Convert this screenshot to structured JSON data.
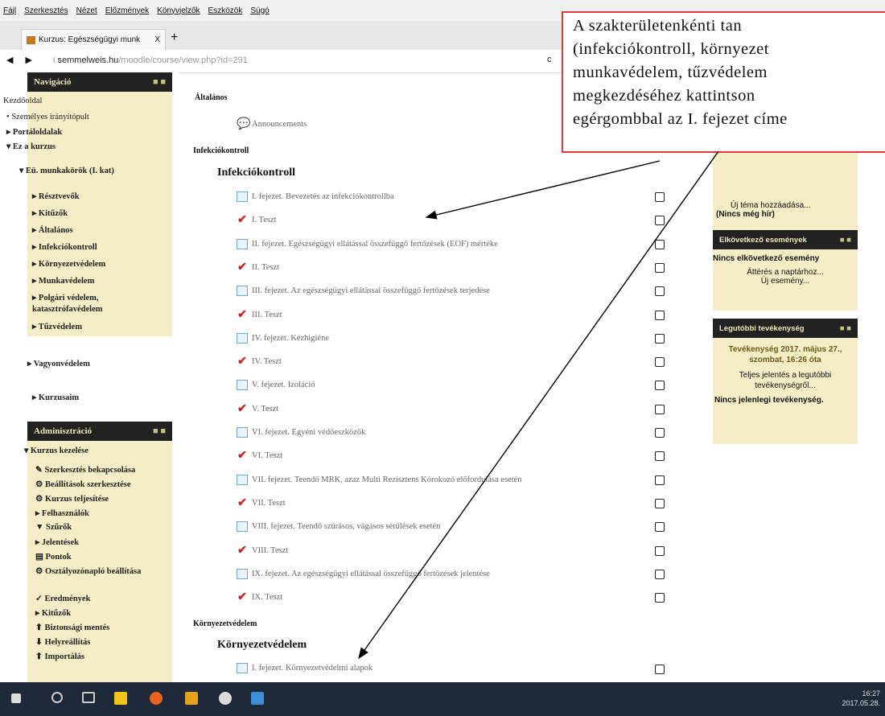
{
  "menu": [
    "Fájl",
    "Szerkesztés",
    "Nézet",
    "Előzmények",
    "Könyvjelzők",
    "Eszközök",
    "Súgó"
  ],
  "tab": {
    "title": "Kurzus: Egészségügyi munk",
    "close": "X",
    "new": "+"
  },
  "url": {
    "prefix": "i.",
    "host": "semmelweis.hu",
    "rest": "/moodle/course/view.php?id=291"
  },
  "navigation": {
    "title": "Navigáció",
    "home": "Kezdőoldal",
    "items": [
      "Személyes irányítópult",
      "Portáloldalak",
      "Ez a kurzus"
    ],
    "course": "Eü. munkakörök (I. kat)",
    "course_items": [
      "Résztvevők",
      "Kitűzők",
      "Általános",
      "Infekciókontroll",
      "Környezetvédelem",
      "Munkavédelem",
      "Polgári védelem, katasztrófavédelem",
      "Tűzvédelem",
      "Vagyonvédelem"
    ],
    "courses": "Kurzusaim"
  },
  "admin": {
    "title": "Adminisztráció",
    "section": "Kurzus kezelése",
    "items": [
      "Szerkesztés bekapcsolása",
      "Beállítások szerkesztése",
      "Kurzus teljesítése",
      "Felhasználók",
      "Szűrők",
      "Jelentések",
      "Pontok",
      "Osztályozónapló beállítása",
      "Eredmények",
      "Kitűzők",
      "Biztonsági mentés",
      "Helyreállítás",
      "Importálás"
    ]
  },
  "main": {
    "general_label": "Általános",
    "announcements": "Announcements",
    "infek_label": "Infekciókontroll",
    "infek_title": "Infekciókontroll",
    "rows": [
      "I. fejezet. Bevezetés az infekciókontrollba",
      "I. Teszt",
      "II. fejezet. Egészségügyi ellátással összefüggő fertőzések (EOF) mértéke",
      "II. Teszt",
      "III. fejezet. Az egészségügyi ellátással összefüggő fertőzések terjedése",
      "III. Teszt",
      "IV. fejezet. Kézhigiéne",
      "IV. Teszt",
      "V. fejezet. Izoláció",
      "V. Teszt",
      "VI. fejezet. Egyéni védőeszközök",
      "VI. Teszt",
      "VII. fejezet. Teendő MRK, azaz Multi Rezisztens Kórokozó előfordulása esetén",
      "VII. Teszt",
      "VIII. fejezet. Teendő szúrásos, vágásos sérülések esetén",
      "VIII. Teszt",
      "IX. fejezet. Az egészségügyi ellátással összefüggő fertőzések jelentése",
      "IX. Teszt"
    ],
    "env_label": "Környezetvédelem",
    "env_title": "Környezetvédelem",
    "env_rows": [
      "I. fejezet. Környezetvédelmi alapok"
    ]
  },
  "right": {
    "forum_add": "Új téma hozzáadása...",
    "forum_none": "(Nincs még hír)",
    "upcoming_title": "Elkövetkező események",
    "upcoming_none": "Nincs elkövetkező esemény",
    "calendar_link": "Áttérés a naptárhoz...",
    "new_event": "Új esemény...",
    "recent_title": "Legutóbbi tevékenység",
    "recent_since": "Tevékenység 2017. május 27., szombat, 16:26 óta",
    "recent_full": "Teljes jelentés a legutóbbi tevékenységről...",
    "recent_none": "Nincs jelenlegi tevékenység."
  },
  "callout": {
    "lines": [
      "A      szakterületenkénti      tan",
      "(infekciókontroll,    környezet",
      "munkavédelem,     tűzvédelem",
      "megkezdéséhez        kattintson",
      "egérgombbal az I. fejezet címe"
    ],
    "border_color": "#e23a3a"
  },
  "clock": {
    "time": "16:27",
    "date": "2017.05.28."
  }
}
